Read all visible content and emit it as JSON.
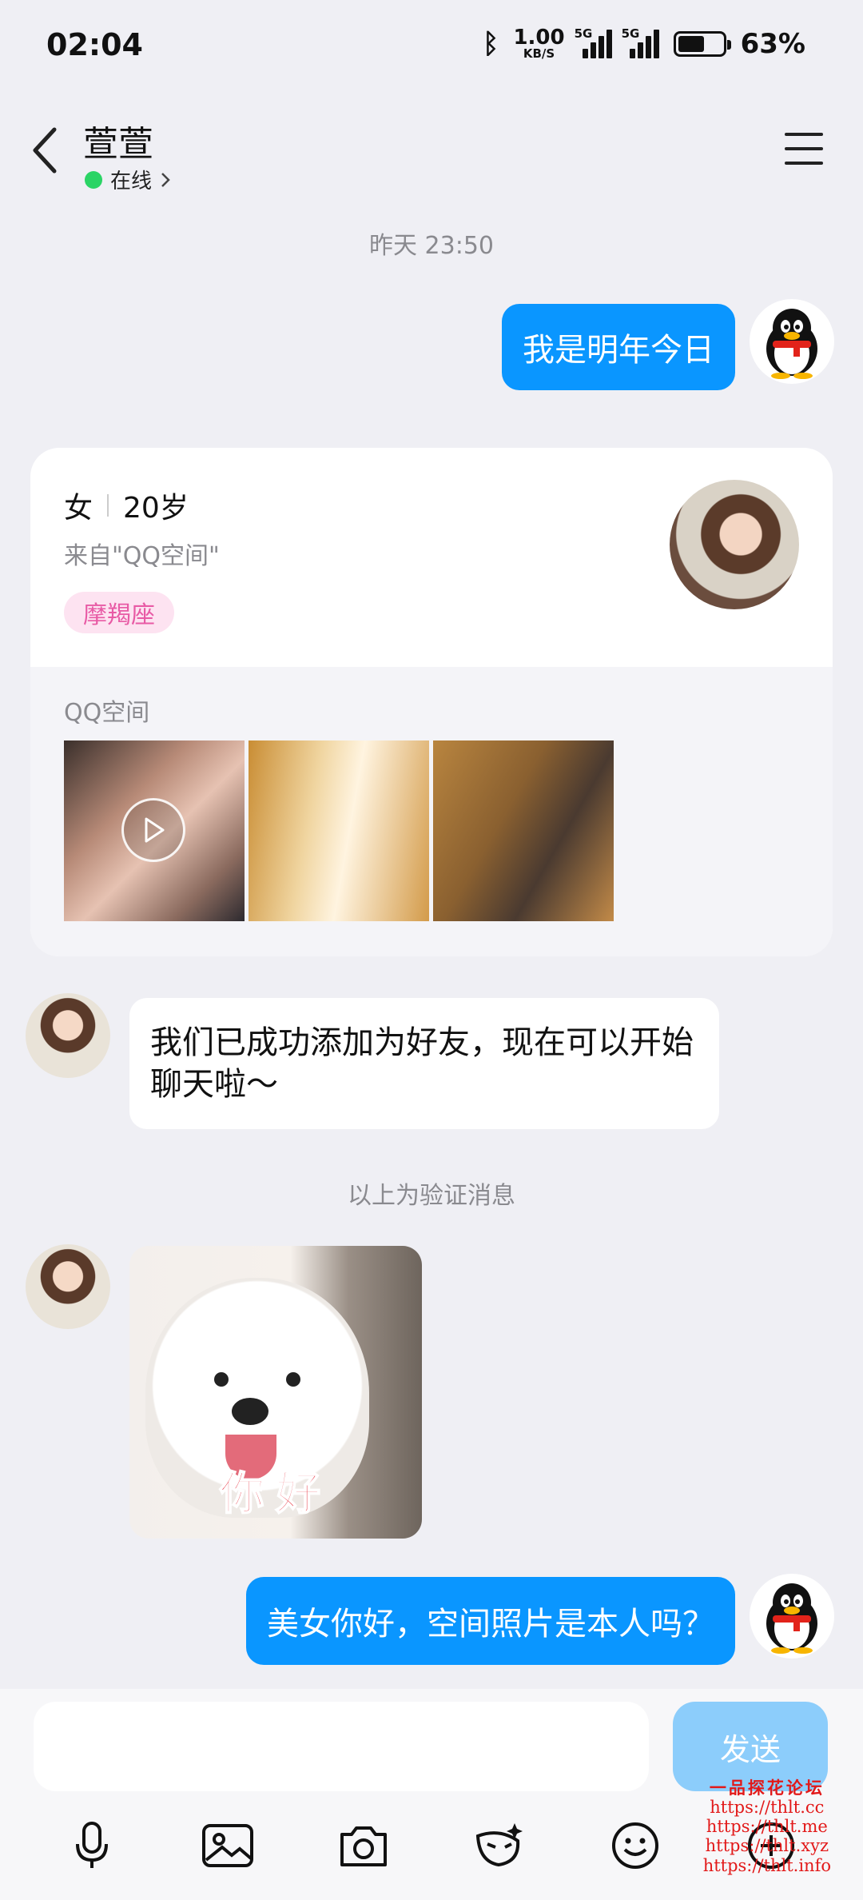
{
  "status_bar": {
    "time": "02:04",
    "net_speed": "1.00",
    "net_unit": "KB/S",
    "signal_tag": "5G",
    "battery_pct": "63%"
  },
  "header": {
    "title": "萱萱",
    "status": "在线"
  },
  "messages": {
    "timestamp": "昨天 23:50",
    "msg1": "我是明年今日",
    "profile": {
      "gender": "女",
      "age": "20岁",
      "from": "来自\"QQ空间\"",
      "zodiac": "摩羯座",
      "qzone_label": "QQ空间"
    },
    "msg2": "我们已成功添加为好友，现在可以开始聊天啦～",
    "verify_note": "以上为验证消息",
    "sticker_text": "你好",
    "msg3": "美女你好，空间照片是本人吗？"
  },
  "input": {
    "placeholder": "",
    "send": "发送"
  },
  "toolbar": [
    "microphone-icon",
    "image-icon",
    "camera-icon",
    "emoji-mask-icon",
    "smile-icon",
    "plus-icon"
  ],
  "watermark": {
    "title": "一品探花论坛",
    "urls": [
      "https://thlt.cc",
      "https://thlt.me",
      "https://thlt.xyz",
      "https://thlt.info"
    ]
  },
  "colors": {
    "bubble_me": "#0a96ff",
    "online": "#2bd465",
    "send_disabled": "#8ccdfb",
    "zodiac_text": "#e85aa5"
  }
}
